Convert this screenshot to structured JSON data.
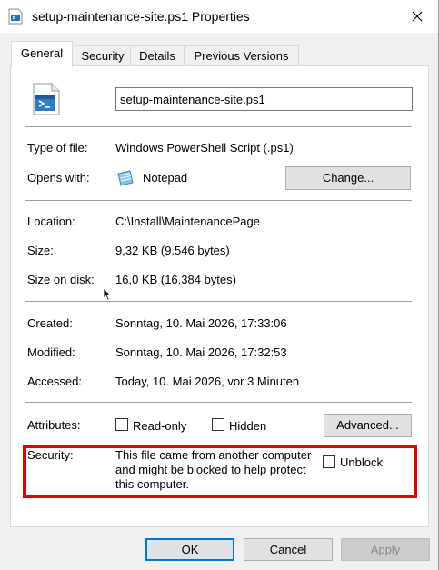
{
  "window": {
    "title": "setup-maintenance-site.ps1 Properties"
  },
  "tabs": [
    {
      "label": "General"
    },
    {
      "label": "Security"
    },
    {
      "label": "Details"
    },
    {
      "label": "Previous Versions"
    }
  ],
  "general": {
    "filename": "setup-maintenance-site.ps1",
    "type_label": "Type of file:",
    "type_value": "Windows PowerShell Script (.ps1)",
    "opens_label": "Opens with:",
    "opens_value": "Notepad",
    "change_button": "Change...",
    "location_label": "Location:",
    "location_value": "C:\\Install\\MaintenancePage",
    "size_label": "Size:",
    "size_value": "9,32 KB (9.546 bytes)",
    "size_disk_label": "Size on disk:",
    "size_disk_value": "16,0 KB (16.384 bytes)",
    "created_label": "Created:",
    "created_value": "Sonntag, 10. Mai 2026, 17:33:06",
    "modified_label": "Modified:",
    "modified_value": "Sonntag, 10. Mai 2026, 17:32:53",
    "accessed_label": "Accessed:",
    "accessed_value": "Today, 10. Mai 2026, vor 3 Minuten",
    "attributes_label": "Attributes:",
    "readonly_label": "Read-only",
    "hidden_label": "Hidden",
    "advanced_button": "Advanced...",
    "security_label": "Security:",
    "security_text": "This file came from another computer and might be blocked to help protect this computer.",
    "unblock_label": "Unblock"
  },
  "footer": {
    "ok": "OK",
    "cancel": "Cancel",
    "apply": "Apply"
  },
  "colors": {
    "highlight": "#e00000",
    "accent": "#0078d7"
  }
}
